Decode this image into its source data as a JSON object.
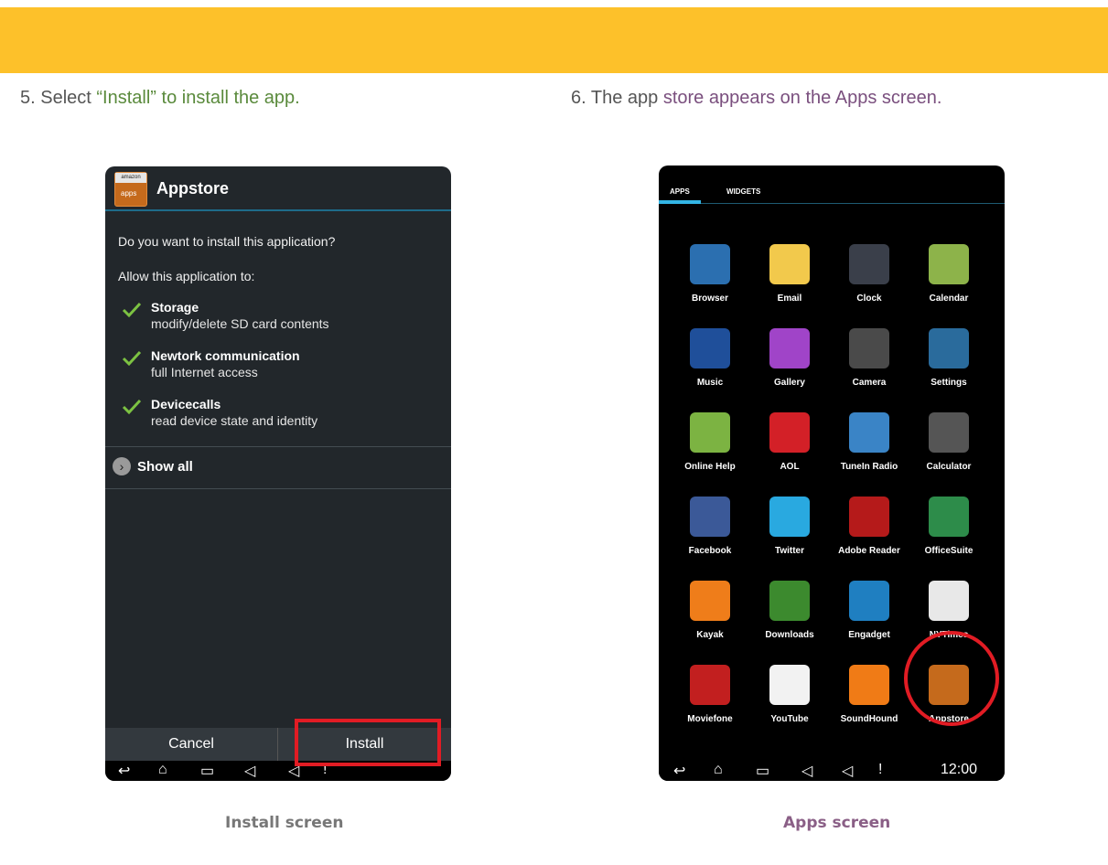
{
  "step5": {
    "prefix": "5. Select ",
    "highlight": "“Install”",
    "rest": " to install the app."
  },
  "step6": {
    "prefix": "6. The app ",
    "highlight": "store appears on the Apps screen."
  },
  "install_screen": {
    "icon": {
      "top": "amazon",
      "bottom": "apps"
    },
    "title": "Appstore",
    "question": "Do you want to install this application?",
    "allow": "Allow this application to:",
    "permissions": [
      {
        "title": "Storage",
        "desc": "modify/delete SD card contents"
      },
      {
        "title": "Newtork communication",
        "desc": "full Internet access"
      },
      {
        "title": "Devicecalls",
        "desc": "read device state and identity"
      }
    ],
    "show_all": "Show all",
    "cancel": "Cancel",
    "install": "Install",
    "caption": "Install screen"
  },
  "apps_screen": {
    "tabs": [
      "APPS",
      "WIDGETS"
    ],
    "apps": [
      {
        "label": "Browser",
        "color": "#2b6fb0"
      },
      {
        "label": "Email",
        "color": "#f2c94c"
      },
      {
        "label": "Clock",
        "color": "#3a3f4a"
      },
      {
        "label": "Calendar",
        "color": "#8db34a"
      },
      {
        "label": "Music",
        "color": "#1f4f9a"
      },
      {
        "label": "Gallery",
        "color": "#a044c8"
      },
      {
        "label": "Camera",
        "color": "#4a4a4a"
      },
      {
        "label": "Settings",
        "color": "#2a6b9c"
      },
      {
        "label": "Online Help",
        "color": "#7cb342"
      },
      {
        "label": "AOL",
        "color": "#d32027"
      },
      {
        "label": "TuneIn Radio",
        "color": "#3a84c6"
      },
      {
        "label": "Calculator",
        "color": "#555555"
      },
      {
        "label": "Facebook",
        "color": "#3b5998"
      },
      {
        "label": "Twitter",
        "color": "#29a9e0"
      },
      {
        "label": "Adobe Reader",
        "color": "#b51a1a"
      },
      {
        "label": "OfficeSuite",
        "color": "#2d8c4a"
      },
      {
        "label": "Kayak",
        "color": "#ef7d1a"
      },
      {
        "label": "Downloads",
        "color": "#3c8a2e"
      },
      {
        "label": "Engadget",
        "color": "#1f7fc1"
      },
      {
        "label": "NYTimes",
        "color": "#e8e8e8"
      },
      {
        "label": "Moviefone",
        "color": "#c21f1f"
      },
      {
        "label": "YouTube",
        "color": "#f2f2f2"
      },
      {
        "label": "SoundHound",
        "color": "#f07b16"
      },
      {
        "label": "Appstore",
        "color": "#c56a1c"
      }
    ],
    "time": "12:00",
    "caption": "Apps screen"
  }
}
